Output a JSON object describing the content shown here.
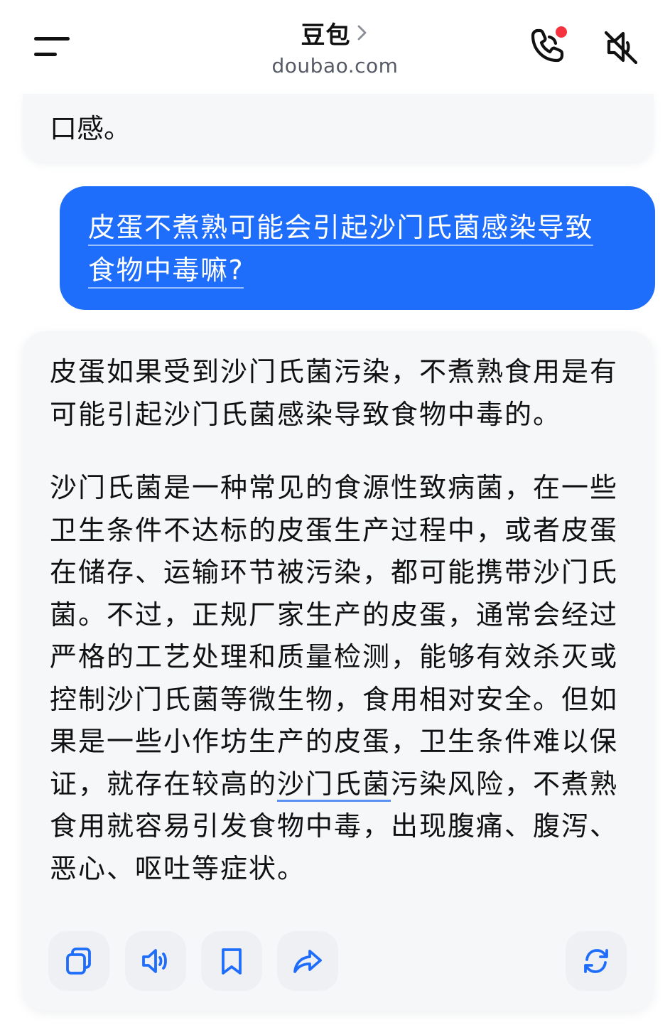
{
  "header": {
    "title": "豆包",
    "domain": "doubao.com"
  },
  "previous_message": {
    "tail_text": "口感。"
  },
  "user_message": {
    "lines": [
      "皮蛋不煮熟可能会引起沙门氏菌感染导致",
      "食物中毒嘛?"
    ]
  },
  "assistant_message": {
    "paragraph1": "皮蛋如果受到沙门氏菌污染，不煮熟食用是有可能引起沙门氏菌感染导致食物中毒的。",
    "paragraph2_before_link": "沙门氏菌是一种常见的食源性致病菌，在一些卫生条件不达标的皮蛋生产过程中，或者皮蛋在储存、运输环节被污染，都可能携带沙门氏菌。不过，正规厂家生产的皮蛋，通常会经过严格的工艺处理和质量检测，能够有效杀灭或控制沙门氏菌等微生物，食用相对安全。但如果是一些小作坊生产的皮蛋，卫生条件难以保证，就存在较高的",
    "paragraph2_link": "沙门氏菌",
    "paragraph2_after_link": "污染风险，不煮熟食用就容易引发食物中毒，出现腹痛、腹泻、恶心、呕吐等症状。"
  },
  "actions": {
    "icons": [
      "copy-icon",
      "speaker-icon",
      "bookmark-icon",
      "share-icon",
      "regenerate-icon"
    ]
  },
  "colors": {
    "accent": "#1f6dfb",
    "bubble_bg": "#f6f7f9",
    "icon_blue": "#1f6dfb",
    "notification_dot": "#f5333f"
  }
}
